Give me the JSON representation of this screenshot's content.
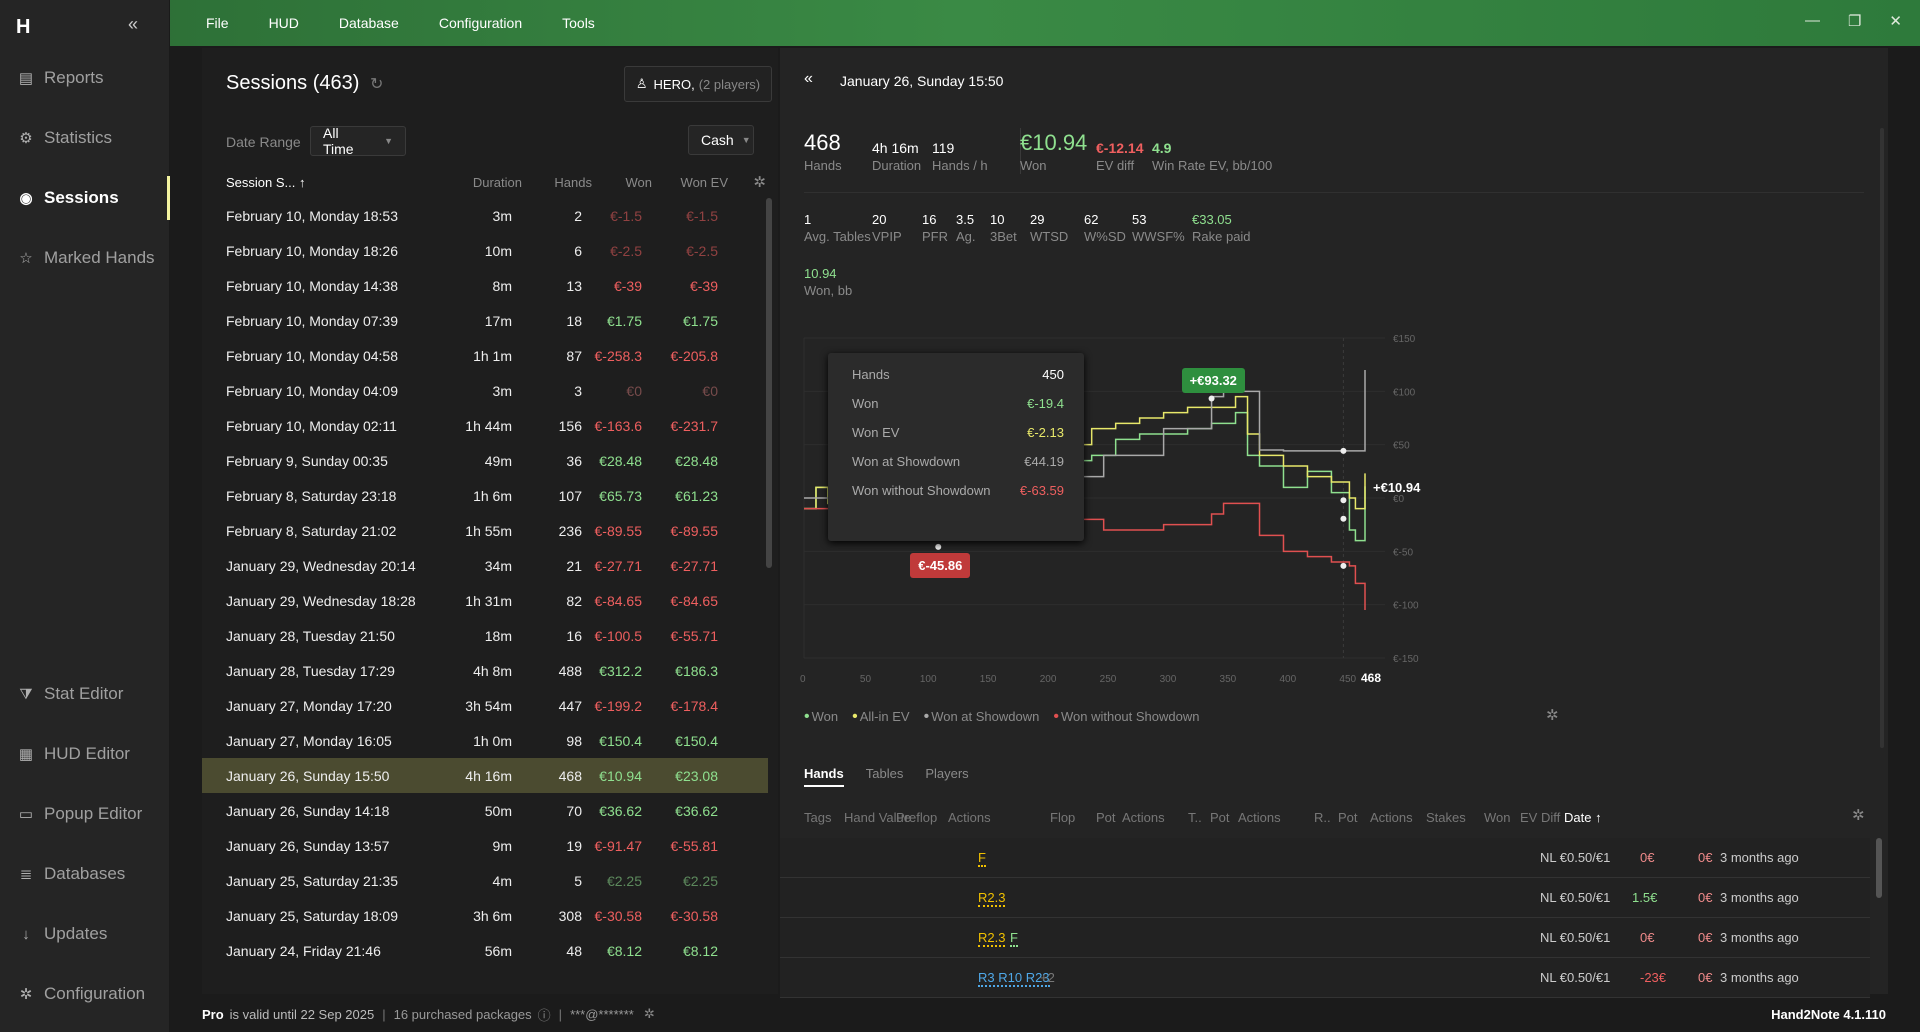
{
  "menu": {
    "items": [
      "File",
      "HUD",
      "Database",
      "Configuration",
      "Tools"
    ]
  },
  "sidebar": {
    "logo": "H",
    "items": [
      {
        "label": "Reports",
        "icon": "report-icon",
        "glyph": "▤"
      },
      {
        "label": "Statistics",
        "icon": "statistics-icon",
        "glyph": "⚙"
      },
      {
        "label": "Sessions",
        "icon": "sessions-icon",
        "glyph": "◉"
      },
      {
        "label": "Marked Hands",
        "icon": "star-icon",
        "glyph": "☆"
      },
      {
        "label": "Stat Editor",
        "icon": "filter-icon",
        "glyph": "⧩"
      },
      {
        "label": "HUD Editor",
        "icon": "hud-editor-icon",
        "glyph": "▦"
      },
      {
        "label": "Popup Editor",
        "icon": "popup-editor-icon",
        "glyph": "▭"
      },
      {
        "label": "Databases",
        "icon": "database-icon",
        "glyph": "≣"
      },
      {
        "label": "Updates",
        "icon": "download-icon",
        "glyph": "↓"
      },
      {
        "label": "Configuration",
        "icon": "gear-icon",
        "glyph": "✲"
      }
    ]
  },
  "sessions": {
    "title": "Sessions (463)",
    "hero": "HERO,",
    "hero_players": "(2 players)",
    "date_range_label": "Date Range",
    "date_range": "All Time",
    "game_type": "Cash",
    "columns": {
      "session": "Session S...",
      "sort": "↑",
      "duration": "Duration",
      "hands": "Hands",
      "won": "Won",
      "won_ev": "Won EV"
    },
    "rows": [
      [
        "February 10, Monday 18:53",
        "3m",
        "2",
        "€-1.5",
        "€-1.5"
      ],
      [
        "February 10, Monday 18:26",
        "10m",
        "6",
        "€-2.5",
        "€-2.5"
      ],
      [
        "February 10, Monday 14:38",
        "8m",
        "13",
        "€-39",
        "€-39"
      ],
      [
        "February 10, Monday 07:39",
        "17m",
        "18",
        "€1.75",
        "€1.75"
      ],
      [
        "February 10, Monday 04:58",
        "1h 1m",
        "87",
        "€-258.3",
        "€-205.8"
      ],
      [
        "February 10, Monday 04:09",
        "3m",
        "3",
        "€0",
        "€0"
      ],
      [
        "February 10, Monday 02:11",
        "1h 44m",
        "156",
        "€-163.6",
        "€-231.7"
      ],
      [
        "February 9, Sunday 00:35",
        "49m",
        "36",
        "€28.48",
        "€28.48"
      ],
      [
        "February 8, Saturday 23:18",
        "1h 6m",
        "107",
        "€65.73",
        "€61.23"
      ],
      [
        "February 8, Saturday 21:02",
        "1h 55m",
        "236",
        "€-89.55",
        "€-89.55"
      ],
      [
        "January 29, Wednesday 20:14",
        "34m",
        "21",
        "€-27.71",
        "€-27.71"
      ],
      [
        "January 29, Wednesday 18:28",
        "1h 31m",
        "82",
        "€-84.65",
        "€-84.65"
      ],
      [
        "January 28, Tuesday 21:50",
        "18m",
        "16",
        "€-100.5",
        "€-55.71"
      ],
      [
        "January 28, Tuesday 17:29",
        "4h 8m",
        "488",
        "€312.2",
        "€186.3"
      ],
      [
        "January 27, Monday 17:20",
        "3h 54m",
        "447",
        "€-199.2",
        "€-178.4"
      ],
      [
        "January 27, Monday 16:05",
        "1h 0m",
        "98",
        "€150.4",
        "€150.4"
      ],
      [
        "January 26, Sunday 15:50",
        "4h 16m",
        "468",
        "€10.94",
        "€23.08"
      ],
      [
        "January 26, Sunday 14:18",
        "50m",
        "70",
        "€36.62",
        "€36.62"
      ],
      [
        "January 26, Sunday 13:57",
        "9m",
        "19",
        "€-91.47",
        "€-55.81"
      ],
      [
        "January 25, Saturday 21:35",
        "4m",
        "5",
        "€2.25",
        "€2.25"
      ],
      [
        "January 25, Saturday 18:09",
        "3h 6m",
        "308",
        "€-30.58",
        "€-30.58"
      ],
      [
        "January 24, Friday 21:46",
        "56m",
        "48",
        "€8.12",
        "€8.12"
      ]
    ],
    "selected_index": 16
  },
  "detail": {
    "date": "January 26, Sunday 15:50",
    "top": [
      {
        "v": "468",
        "l": "Hands"
      },
      {
        "v": "4h 16m",
        "l": "Duration"
      },
      {
        "v": "119",
        "l": "Hands / h"
      },
      {
        "v": "€10.94",
        "l": "Won"
      },
      {
        "v": "€-12.14",
        "l": "EV diff"
      },
      {
        "v": "4.9",
        "l": "Win Rate EV, bb/100"
      }
    ],
    "stats": [
      {
        "v": "1",
        "l": "Avg. Tables"
      },
      {
        "v": "20",
        "l": "VPIP"
      },
      {
        "v": "16",
        "l": "PFR"
      },
      {
        "v": "3.5",
        "l": "Ag."
      },
      {
        "v": "10",
        "l": "3Bet"
      },
      {
        "v": "29",
        "l": "WTSD"
      },
      {
        "v": "62",
        "l": "W%SD"
      },
      {
        "v": "53",
        "l": "WWSF%"
      },
      {
        "v": "€33.05",
        "l": "Rake paid"
      }
    ],
    "won_bb": {
      "v": "10.94",
      "l": "Won, bb"
    },
    "tooltip": [
      [
        "Hands",
        "450"
      ],
      [
        "Won",
        "€-19.4"
      ],
      [
        "Won EV",
        "€-2.13"
      ],
      [
        "Won at Showdown",
        "€44.19"
      ],
      [
        "Won without Showdown",
        "€-63.59"
      ]
    ],
    "markers": {
      "max": "+€93.32",
      "min": "€-45.86",
      "end": "+€10.94"
    },
    "legend": [
      "Won",
      "All-in EV",
      "Won at Showdown",
      "Won without Showdown"
    ],
    "tabs": [
      "Hands",
      "Tables",
      "Players"
    ],
    "hand_cols": [
      "Tags",
      "Hand Value",
      "Preflop",
      "Actions",
      "Flop",
      "Pot",
      "Actions",
      "T..",
      "Pot",
      "Actions",
      "R..",
      "Pot",
      "Actions",
      "Stakes",
      "Won",
      "EV Diff",
      "Date ↑"
    ],
    "hands": [
      {
        "preflop": "F",
        "stakes": "NL €0.50/€1",
        "won": "0€",
        "ev": "0€",
        "date": "3 months ago"
      },
      {
        "preflop": "R2.3",
        "stakes": "NL €0.50/€1",
        "won": "1.5€",
        "ev": "0€",
        "date": "3 months ago"
      },
      {
        "preflop": "R2.3",
        "extra": "F",
        "stakes": "NL €0.50/€1",
        "won": "0€",
        "ev": "0€",
        "date": "3 months ago"
      },
      {
        "preflop": "R3 R10 R23",
        "extra": "+2",
        "stakes": "NL €0.50/€1",
        "won": "-23€",
        "ev": "0€",
        "date": "3 months ago"
      }
    ]
  },
  "chart_data": {
    "type": "line",
    "xlim": [
      0,
      468
    ],
    "ylim": [
      -150,
      150
    ],
    "x_ticks": [
      "0",
      "50",
      "100",
      "150",
      "200",
      "250",
      "300",
      "350",
      "400",
      "450",
      "468"
    ],
    "y_ticks": [
      "€150",
      "€100",
      "€50",
      "€0",
      "€-50",
      "€-100",
      "€-150"
    ],
    "series": [
      {
        "name": "Won",
        "color": "#8fe08f",
        "x": [
          0,
          10,
          20,
          40,
          60,
          80,
          100,
          120,
          140,
          160,
          180,
          200,
          220,
          240,
          260,
          280,
          300,
          320,
          340,
          360,
          370,
          380,
          400,
          420,
          440,
          455,
          460,
          468
        ],
        "values": [
          -10,
          10,
          -5,
          25,
          15,
          30,
          -20,
          -10,
          5,
          25,
          20,
          20,
          35,
          40,
          55,
          60,
          60,
          65,
          70,
          80,
          40,
          30,
          10,
          25,
          5,
          -30,
          -40,
          10.94
        ]
      },
      {
        "name": "All-in EV",
        "color": "#e8e86a",
        "x": [
          0,
          10,
          20,
          40,
          60,
          80,
          100,
          120,
          140,
          160,
          180,
          200,
          220,
          240,
          260,
          280,
          300,
          320,
          340,
          360,
          370,
          380,
          400,
          420,
          440,
          455,
          460,
          468
        ],
        "values": [
          -10,
          10,
          -5,
          25,
          15,
          30,
          -20,
          -10,
          5,
          25,
          25,
          30,
          50,
          65,
          70,
          75,
          80,
          85,
          85,
          95,
          60,
          40,
          30,
          20,
          15,
          0,
          -10,
          23.08
        ]
      },
      {
        "name": "Won at Showdown",
        "color": "#a9a9a9",
        "x": [
          0,
          50,
          100,
          150,
          200,
          250,
          300,
          340,
          350,
          380,
          400,
          450,
          468
        ],
        "values": [
          0,
          5,
          10,
          15,
          20,
          40,
          65,
          95,
          100,
          45,
          44.19,
          44.19,
          120
        ]
      },
      {
        "name": "Won without Showdown",
        "color": "#e05050",
        "x": [
          0,
          50,
          100,
          150,
          200,
          250,
          300,
          340,
          350,
          380,
          400,
          420,
          440,
          455,
          460,
          468
        ],
        "values": [
          -10,
          -15,
          -20,
          -25,
          -20,
          -30,
          -25,
          -15,
          -5,
          -35,
          -50,
          -55,
          -60,
          -63.59,
          -80,
          -105
        ]
      }
    ]
  },
  "status": {
    "pro": "Pro",
    "valid": "is valid until 22 Sep 2025",
    "packages": "16 purchased packages",
    "account": "***@*******",
    "version": "Hand2Note 4.1.110"
  }
}
